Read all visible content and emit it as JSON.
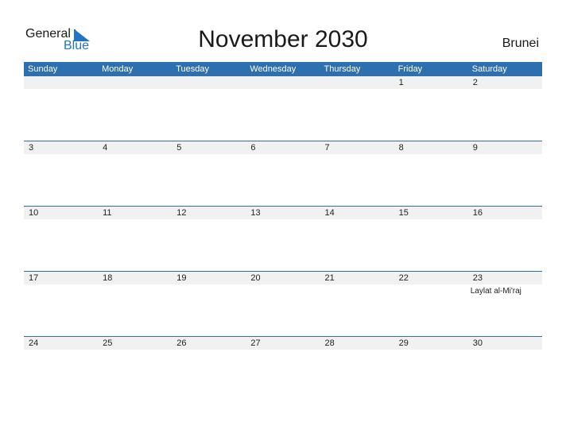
{
  "logo": {
    "line1": "General",
    "line2": "Blue"
  },
  "title": "November 2030",
  "country": "Brunei",
  "colors": {
    "header_bg": "#2e6fb0",
    "brand_blue": "#2574c4",
    "row_bg": "#f1f1f1"
  },
  "weekdays": [
    "Sunday",
    "Monday",
    "Tuesday",
    "Wednesday",
    "Thursday",
    "Friday",
    "Saturday"
  ],
  "weeks": [
    [
      {
        "day": ""
      },
      {
        "day": ""
      },
      {
        "day": ""
      },
      {
        "day": ""
      },
      {
        "day": ""
      },
      {
        "day": "1"
      },
      {
        "day": "2"
      }
    ],
    [
      {
        "day": "3"
      },
      {
        "day": "4"
      },
      {
        "day": "5"
      },
      {
        "day": "6"
      },
      {
        "day": "7"
      },
      {
        "day": "8"
      },
      {
        "day": "9"
      }
    ],
    [
      {
        "day": "10"
      },
      {
        "day": "11"
      },
      {
        "day": "12"
      },
      {
        "day": "13"
      },
      {
        "day": "14"
      },
      {
        "day": "15"
      },
      {
        "day": "16"
      }
    ],
    [
      {
        "day": "17"
      },
      {
        "day": "18"
      },
      {
        "day": "19"
      },
      {
        "day": "20"
      },
      {
        "day": "21"
      },
      {
        "day": "22"
      },
      {
        "day": "23",
        "holiday": "Laylat al-Mi'raj"
      }
    ],
    [
      {
        "day": "24"
      },
      {
        "day": "25"
      },
      {
        "day": "26"
      },
      {
        "day": "27"
      },
      {
        "day": "28"
      },
      {
        "day": "29"
      },
      {
        "day": "30"
      }
    ]
  ]
}
